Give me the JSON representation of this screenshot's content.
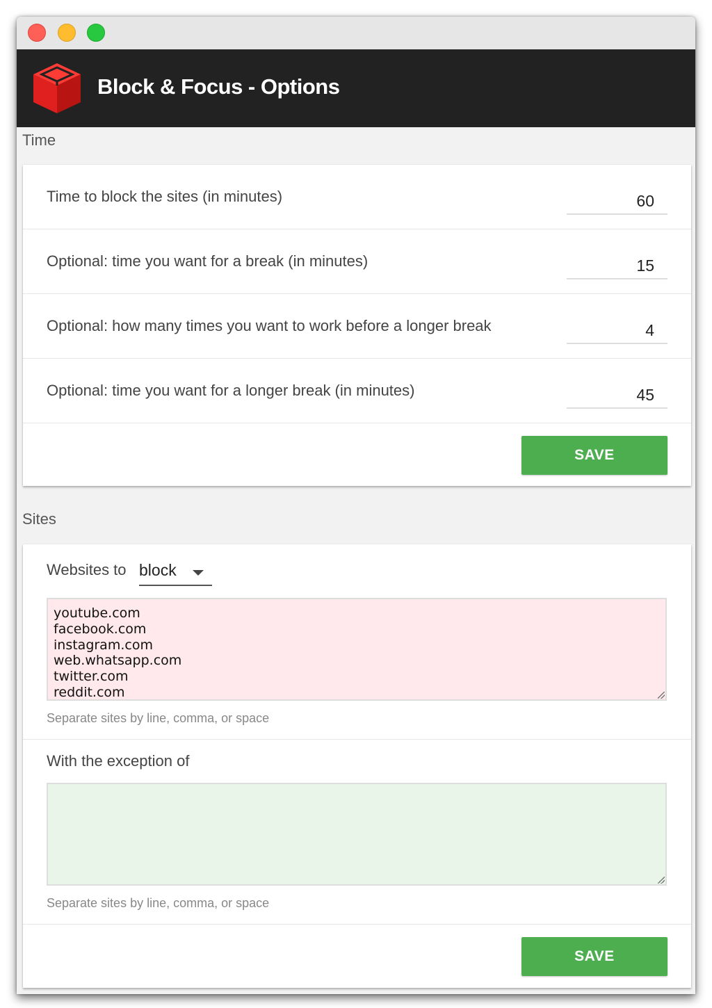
{
  "app": {
    "title": "Block & Focus - Options"
  },
  "time_section": {
    "heading": "Time",
    "rows": [
      {
        "label": "Time to block the sites (in minutes)",
        "value": "60"
      },
      {
        "label": "Optional: time you want for a break (in minutes)",
        "value": "15"
      },
      {
        "label": "Optional: how many times you want to work before a longer break",
        "value": "4"
      },
      {
        "label": "Optional: time you want for a longer break (in minutes)",
        "value": "45"
      }
    ],
    "save_label": "SAVE"
  },
  "sites_section": {
    "heading": "Sites",
    "websites_label": "Websites to",
    "mode_value": "block",
    "blocked_sites": "youtube.com\nfacebook.com\ninstagram.com\nweb.whatsapp.com\ntwitter.com\nreddit.com",
    "hint": "Separate sites by line, comma, or space",
    "exception_label": "With the exception of",
    "exception_sites": "",
    "exception_hint": "Separate sites by line, comma, or space",
    "save_label": "SAVE"
  },
  "colors": {
    "appbar": "#222222",
    "logo_red": "#e0201e",
    "save_green": "#4cae4f",
    "block_area_bg": "#ffe9ec",
    "except_area_bg": "#e9f5e9"
  },
  "icons": {
    "logo": "red-cube-icon",
    "dropdown": "caret-down-icon"
  }
}
